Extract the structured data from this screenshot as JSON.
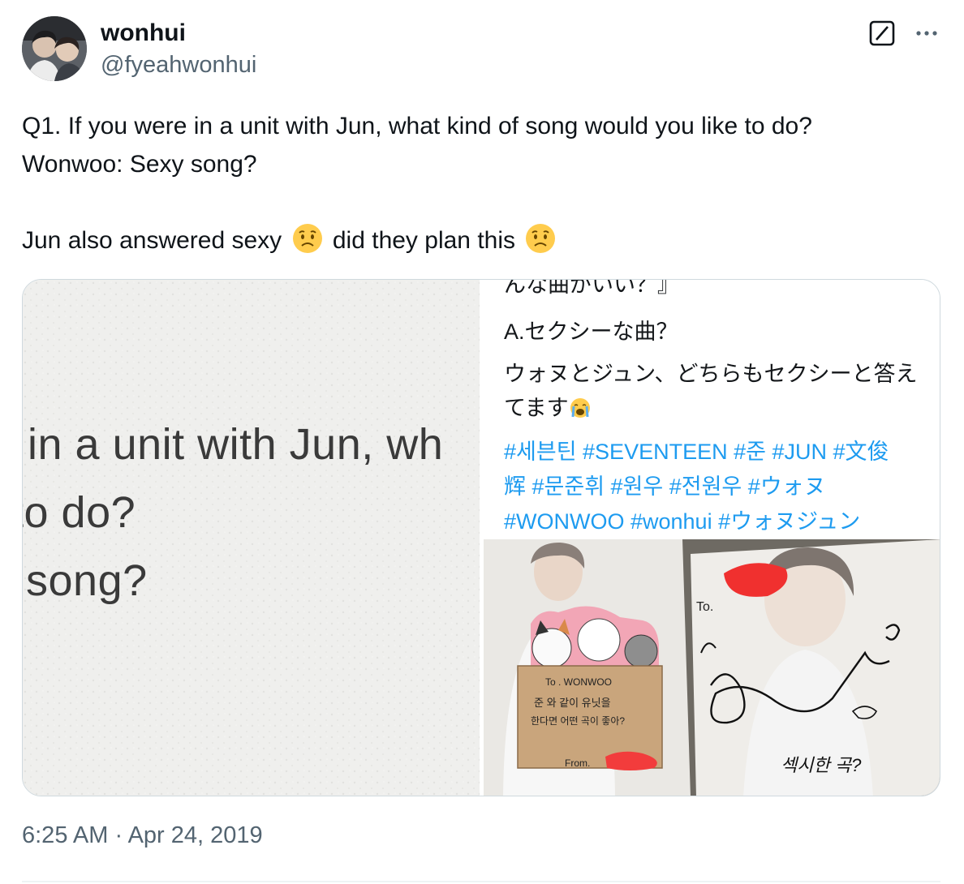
{
  "user": {
    "display_name": "wonhui",
    "handle": "@fyeahwonhui"
  },
  "header": {
    "grok_icon": "grok-icon",
    "more_icon": "more-icon"
  },
  "tweet": {
    "line1": "Q1. If you were in a unit with Jun, what kind of song would you like to do?",
    "line2": "Wonwoo: Sexy song?",
    "line3a": "Jun also answered sexy",
    "line3b": "did they plan this",
    "emoji": "worried-face-emoji"
  },
  "media": {
    "left": {
      "line1": "in a unit with Jun, wh",
      "line2": "to do?",
      "line3": "song?"
    },
    "right": {
      "jp_top": "んな曲がいい？』",
      "jp_answer": "A.セクシーな曲？",
      "jp_body1": "ウォヌとジュン、どちらもセクシーと答え",
      "jp_body2": "てます",
      "hashtags1": "#세븐틴 #SEVENTEEN #준 #JUN #文俊",
      "hashtags2": "辉 #문준휘 #원우 #전원우 #ウォヌ",
      "hashtags3": "#WONWOO #wonhui #ウォヌジュン"
    },
    "photo": {
      "card_to": "To . WONWOO",
      "card_q1": "준 와 같이 유닛을",
      "card_q2": "한다면 어떤 곡이 좋아?",
      "card_from": "From.",
      "page_to": "To.",
      "answer": "섹시한 곡?"
    }
  },
  "footer": {
    "timestamp": "6:25 AM · Apr 24, 2019"
  },
  "colors": {
    "link": "#1d9bf0",
    "secondary": "#536471",
    "border": "#cfd9de"
  }
}
